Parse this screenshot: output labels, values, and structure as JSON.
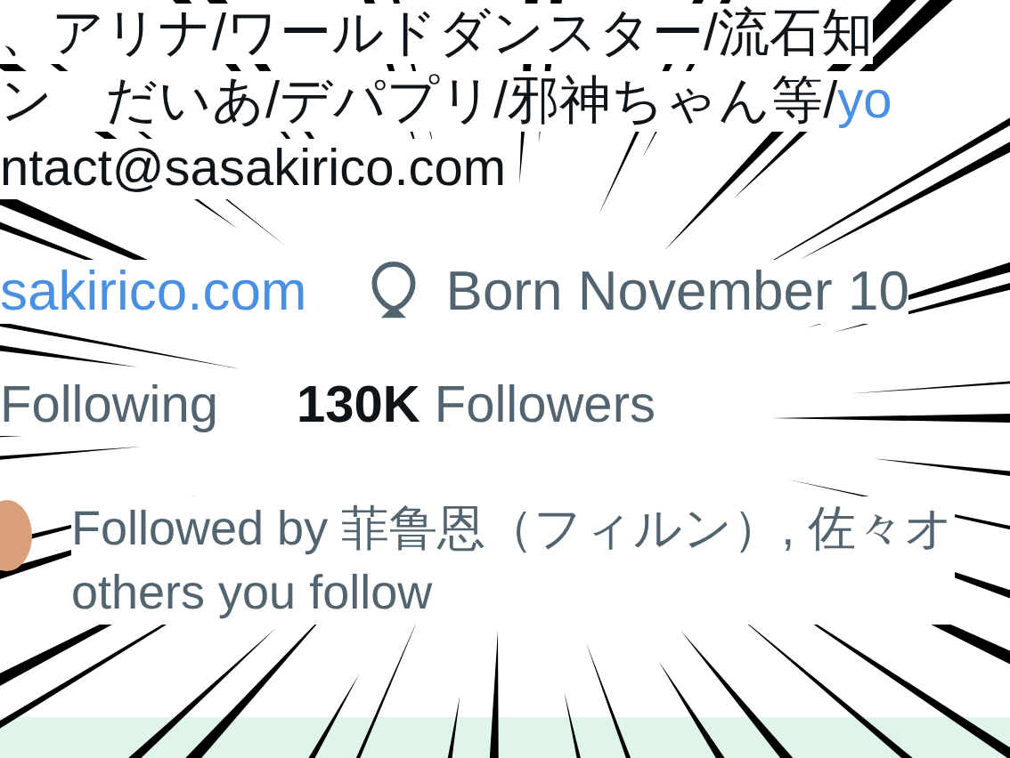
{
  "bio": {
    "lines": [
      {
        "text": "、アリナ/ワールドダンスター/流石知"
      },
      {
        "text": "ン　だいあ/デパプリ/邪神ちゃん等/",
        "link": "yo"
      },
      {
        "text": "ntact@sasakirico.com"
      }
    ]
  },
  "meta": {
    "website": "sakirico.com",
    "birthday": "Born November 10"
  },
  "stats": [
    {
      "label": "Following"
    },
    {
      "count": "130K",
      "label": "Followers"
    }
  ],
  "followed_by": {
    "line1": "Followed by 菲鲁恩（フィルン）, 佐々オ",
    "line2": "others you follow"
  }
}
